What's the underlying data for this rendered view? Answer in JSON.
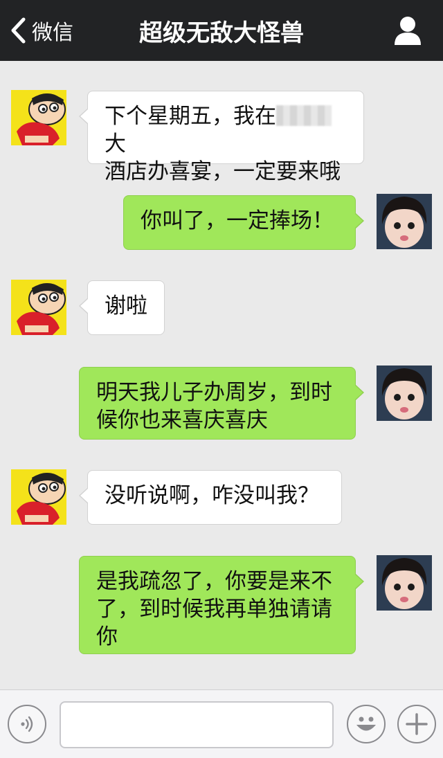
{
  "header": {
    "back_label": "微信",
    "title": "超级无敌大怪兽"
  },
  "messages": [
    {
      "side": "left",
      "lines": [
        "下个星期五，我在",
        "大",
        "酒店办喜宴，一定要来哦"
      ]
    },
    {
      "side": "right",
      "text": "你叫了，一定捧场！"
    },
    {
      "side": "left",
      "text": "谢啦"
    },
    {
      "side": "right",
      "lines": [
        "明天我儿子办周岁，到时",
        "候你也来喜庆喜庆"
      ]
    },
    {
      "side": "left",
      "text": "没听说啊，咋没叫我？"
    },
    {
      "side": "right",
      "lines": [
        "是我疏忽了，你要是来不",
        "了，到时候我再单独请请",
        "你"
      ]
    }
  ],
  "input": {
    "value": "",
    "placeholder": ""
  },
  "colors": {
    "header_bg": "#222325",
    "chat_bg": "#eaeaea",
    "incoming_bubble": "#ffffff",
    "outgoing_bubble": "#a0e75a"
  },
  "icons": {
    "back": "chevron-left-icon",
    "contact": "person-icon",
    "voice": "voice-icon",
    "emoji": "smiley-icon",
    "more": "plus-icon"
  }
}
